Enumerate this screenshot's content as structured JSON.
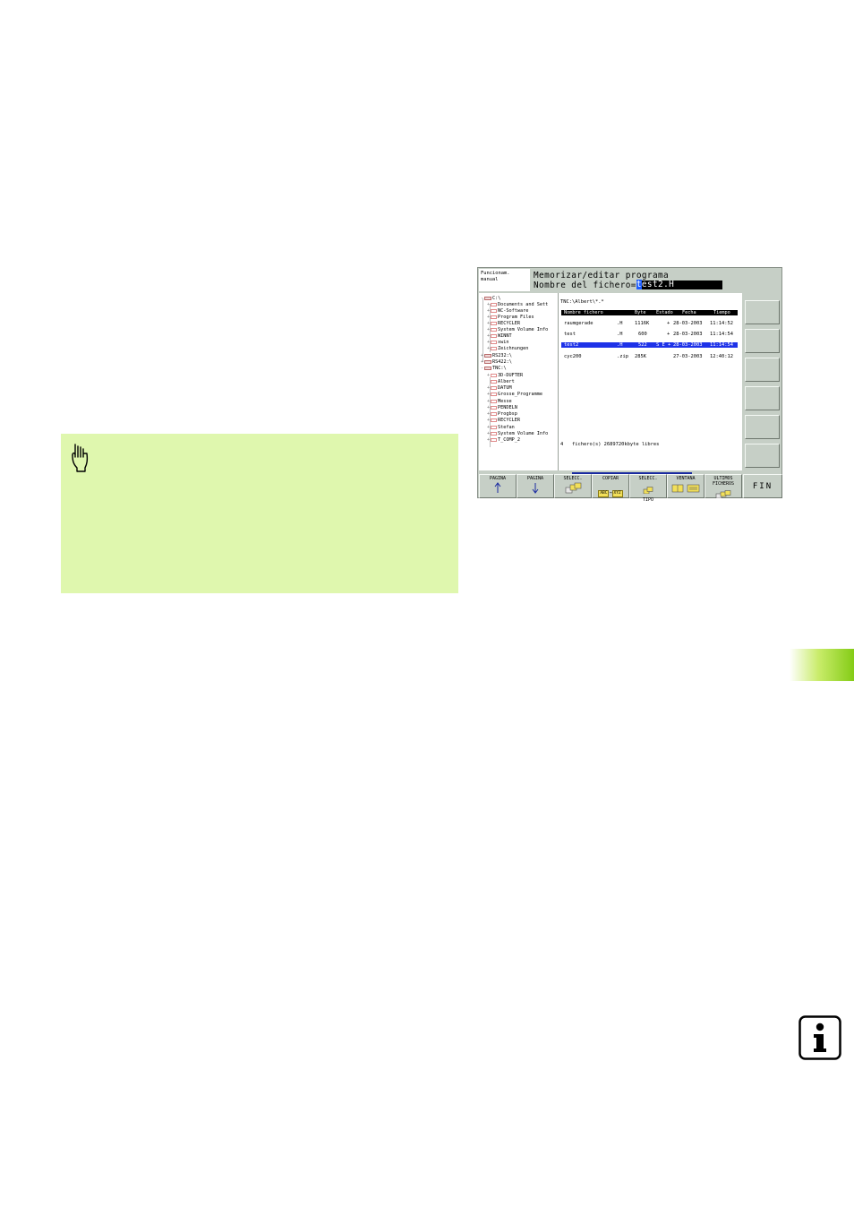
{
  "tnc": {
    "mode_line1": "Funcionam.",
    "mode_line2": "manual",
    "title": "Memorizar/editar programa",
    "prompt": "Nombre del fichero=",
    "input_cursor": "t",
    "input_rest": "est2.H",
    "tree": [
      {
        "label": "C:\\",
        "kind": "drive",
        "level": 0
      },
      {
        "label": "Documents and Sett",
        "kind": "folder",
        "level": 1
      },
      {
        "label": "NC-Software",
        "kind": "folder",
        "level": 1
      },
      {
        "label": "Program Files",
        "kind": "folder",
        "level": 1
      },
      {
        "label": "RECYCLER",
        "kind": "folder",
        "level": 1
      },
      {
        "label": "System Volume Info",
        "kind": "folder",
        "level": 1
      },
      {
        "label": "WINNT",
        "kind": "folder",
        "level": 1
      },
      {
        "label": "xwin",
        "kind": "folder",
        "level": 1
      },
      {
        "label": "Zeichnungen",
        "kind": "folder",
        "level": 1
      },
      {
        "label": "RS232:\\",
        "kind": "drive",
        "level": 0
      },
      {
        "label": "RS422:\\",
        "kind": "drive",
        "level": 0
      },
      {
        "label": "TNC:\\",
        "kind": "drive",
        "level": 0
      },
      {
        "label": "3D-DUFTER",
        "kind": "folder",
        "level": 1
      },
      {
        "label": "Albert",
        "kind": "folder",
        "level": 1
      },
      {
        "label": "DATUM",
        "kind": "folder",
        "level": 1
      },
      {
        "label": "Grosse_Programme",
        "kind": "folder",
        "level": 1
      },
      {
        "label": "Messe",
        "kind": "folder",
        "level": 1
      },
      {
        "label": "PENDELN",
        "kind": "folder",
        "level": 1
      },
      {
        "label": "Progbsp",
        "kind": "folder",
        "level": 1
      },
      {
        "label": "RECYCLER",
        "kind": "folder",
        "level": 1
      },
      {
        "label": "Stefan",
        "kind": "folder",
        "level": 1
      },
      {
        "label": "System Volume Info",
        "kind": "folder",
        "level": 1
      },
      {
        "label": "T_COMP_2",
        "kind": "folder",
        "level": 1
      }
    ],
    "path": "TNC:\\Albert\\*.*",
    "columns": [
      "Nombre fichero",
      "Byte",
      "Estado",
      "Fecha",
      "Tiempo"
    ],
    "files": [
      {
        "name": "raumgerade",
        "ext": ".H",
        "size": "1116K",
        "status": "+",
        "date": "28-03-2003",
        "time": "11:14:52",
        "selected": false
      },
      {
        "name": "test",
        "ext": ".H",
        "size": "600",
        "status": "+",
        "date": "28-03-2003",
        "time": "11:14:54",
        "selected": false
      },
      {
        "name": "test2",
        "ext": ".H",
        "size": "522",
        "status": "S E +",
        "date": "28-03-2003",
        "time": "11:14:54",
        "selected": true
      },
      {
        "name": "cyc200",
        "ext": ".zip",
        "size": "285K",
        "status": "",
        "date": "27-03-2003",
        "time": "12:40:12",
        "selected": false
      }
    ],
    "summary": "4   fichero(s) 2689720kbyte libres",
    "softkeys": {
      "pagina_up": "PAGINA",
      "pagina_down": "PAGINA",
      "select": "SELECC.",
      "copy": "COPIAR",
      "copy_from": "ABC",
      "copy_to": "XYZ",
      "select_type_1": "SELECC.",
      "select_type_2": "TIPO",
      "window": "VENTANA",
      "last_files_1": "ULTIMOS",
      "last_files_2": "FICHEROS",
      "end": "FIN"
    }
  }
}
